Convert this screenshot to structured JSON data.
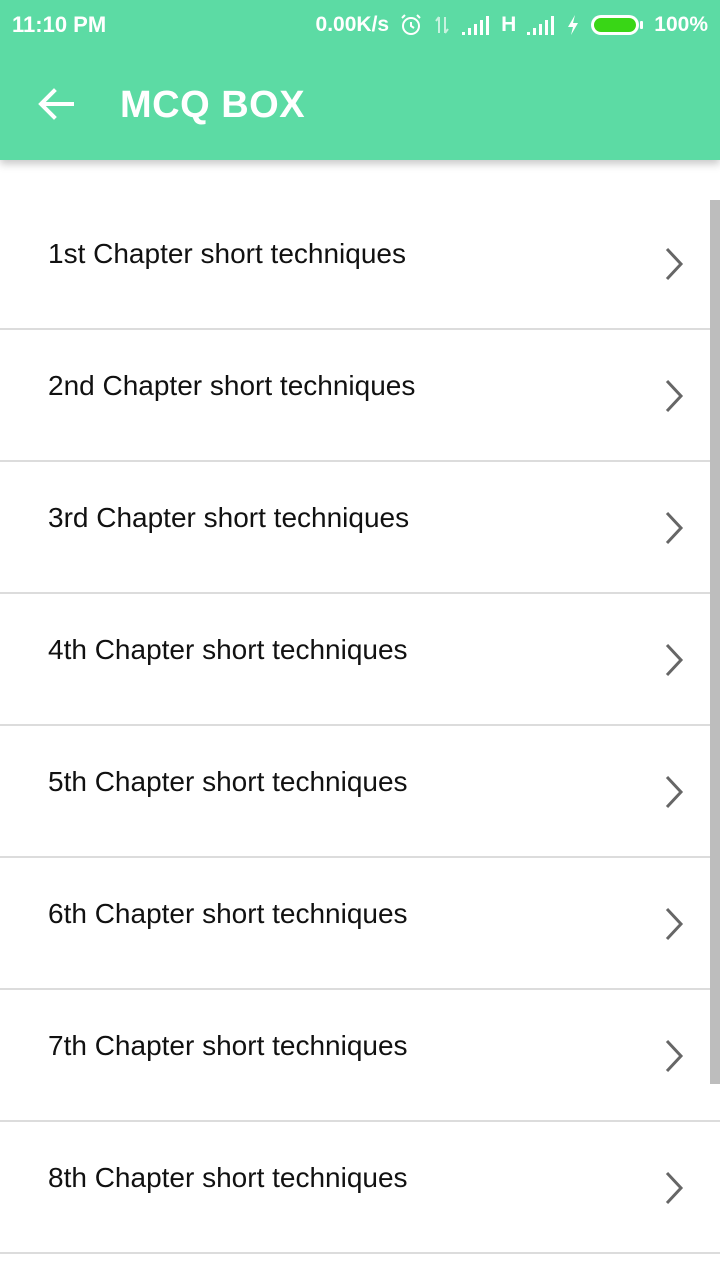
{
  "status_bar": {
    "time": "11:10 PM",
    "network_speed": "0.00K/s",
    "network_type": "H",
    "battery_percent": "100%",
    "icons": [
      "alarm-icon",
      "data-arrows-icon",
      "signal-icon",
      "signal-icon",
      "charging-icon",
      "battery-icon"
    ]
  },
  "toolbar": {
    "title": "MCQ BOX",
    "back_icon": "arrow-left-icon"
  },
  "chapters": [
    {
      "label": "1st Chapter short techniques"
    },
    {
      "label": "2nd Chapter short techniques"
    },
    {
      "label": "3rd Chapter short techniques"
    },
    {
      "label": "4th Chapter short techniques"
    },
    {
      "label": "5th Chapter short techniques"
    },
    {
      "label": "6th Chapter short techniques"
    },
    {
      "label": "7th Chapter short techniques"
    },
    {
      "label": "8th Chapter short techniques"
    }
  ],
  "colors": {
    "accent": "#5cdba4",
    "battery": "#39d616",
    "text": "#111111",
    "chevron": "#666666"
  }
}
